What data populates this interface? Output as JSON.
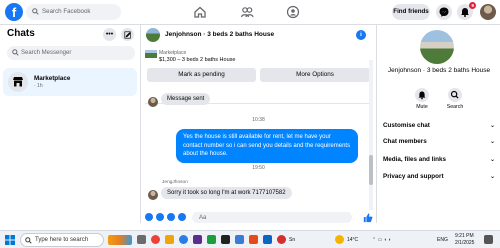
{
  "topbar": {
    "logo_letter": "f",
    "search_placeholder": "Search Facebook",
    "find_friends": "Find friends",
    "notification_count": "9"
  },
  "left": {
    "title": "Chats",
    "search_placeholder": "Search Messenger",
    "chat_name": "Marketplace",
    "chat_time": "· 1h"
  },
  "conversation": {
    "title": "Jenjohnson · 3 beds 2 baths House",
    "marketplace_label": "Marketplace",
    "listing": "$1,300 – 3 beds 2 baths House",
    "mark_pending": "Mark as pending",
    "more_options": "More Options",
    "msg1": "Message sent",
    "time1": "10:38",
    "msg2": "Yes the house is still available for rent, let me have your contact number so i can send you details and the requirements about the house.",
    "time2": "19:50",
    "sender": "JengJhnson",
    "msg3": "Sorry it took so long I'm at work 7177107582",
    "composer_placeholder": "Aa"
  },
  "right": {
    "name": "Jenjohnson · 3 beds 2 baths House",
    "mute": "Mute",
    "search": "Search",
    "menu": [
      "Customise chat",
      "Chat members",
      "Media, files and links",
      "Privacy and support"
    ]
  },
  "taskbar": {
    "search_placeholder": "Type here to search",
    "weather": "14°C",
    "time": "9:21 PM",
    "date": "2/1/2025",
    "lang": "ENG",
    "app_label": "Sn"
  },
  "colors": {
    "accent": "#1877f2",
    "bubble_out": "#0084ff",
    "bubble_in": "#e4e6eb"
  }
}
